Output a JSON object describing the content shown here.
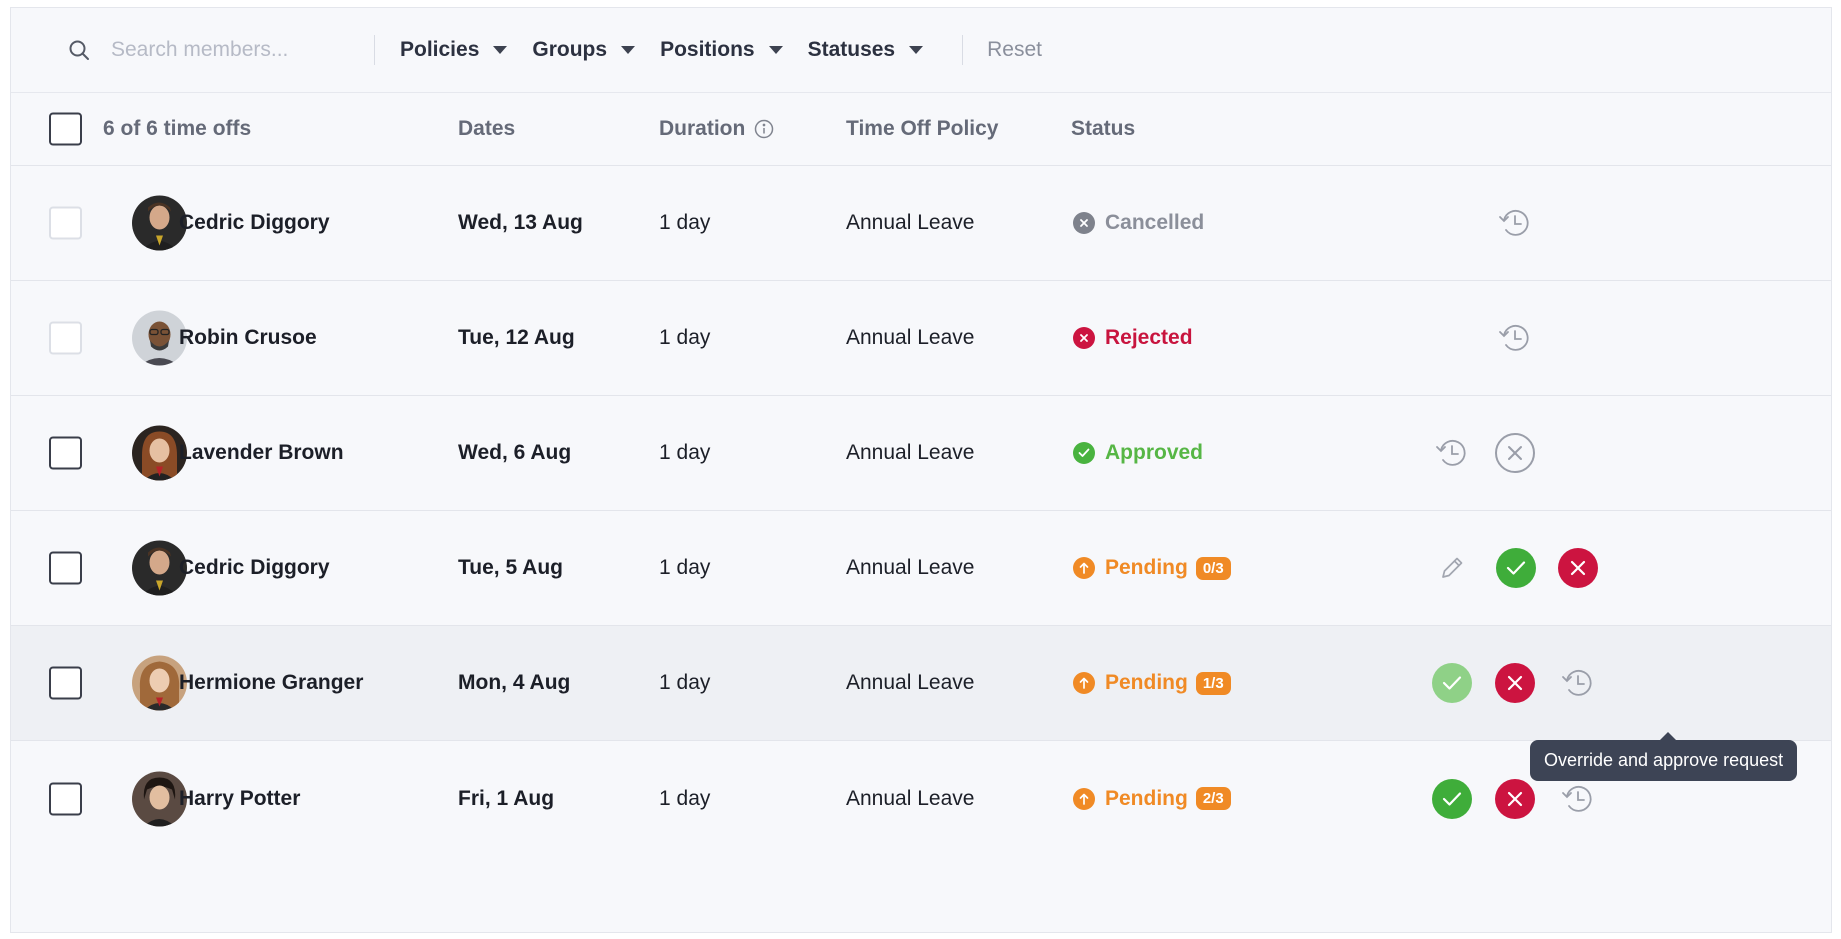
{
  "toolbar": {
    "search_placeholder": "Search members...",
    "filters": [
      "Policies",
      "Groups",
      "Positions",
      "Statuses"
    ],
    "reset_label": "Reset"
  },
  "table": {
    "headers": {
      "count": "6 of 6 time offs",
      "dates": "Dates",
      "duration": "Duration",
      "policy": "Time Off Policy",
      "status": "Status"
    },
    "rows": [
      {
        "name": "Cedric Diggory",
        "date": "Wed, 13 Aug",
        "duration": "1 day",
        "policy": "Annual Leave",
        "status": "Cancelled",
        "badge": ""
      },
      {
        "name": "Robin Crusoe",
        "date": "Tue, 12 Aug",
        "duration": "1 day",
        "policy": "Annual Leave",
        "status": "Rejected",
        "badge": ""
      },
      {
        "name": "Lavender Brown",
        "date": "Wed, 6 Aug",
        "duration": "1 day",
        "policy": "Annual Leave",
        "status": "Approved",
        "badge": ""
      },
      {
        "name": "Cedric Diggory",
        "date": "Tue, 5 Aug",
        "duration": "1 day",
        "policy": "Annual Leave",
        "status": "Pending",
        "badge": "0/3"
      },
      {
        "name": "Hermione Granger",
        "date": "Mon, 4 Aug",
        "duration": "1 day",
        "policy": "Annual Leave",
        "status": "Pending",
        "badge": "1/3"
      },
      {
        "name": "Harry Potter",
        "date": "Fri, 1 Aug",
        "duration": "1 day",
        "policy": "Annual Leave",
        "status": "Pending",
        "badge": "2/3"
      }
    ]
  },
  "tooltip": {
    "text": "Override and approve request"
  },
  "colors": {
    "approve": "#3fad3a",
    "reject": "#cc1440",
    "pending": "#f08a25",
    "cancelled": "#7e828c"
  }
}
